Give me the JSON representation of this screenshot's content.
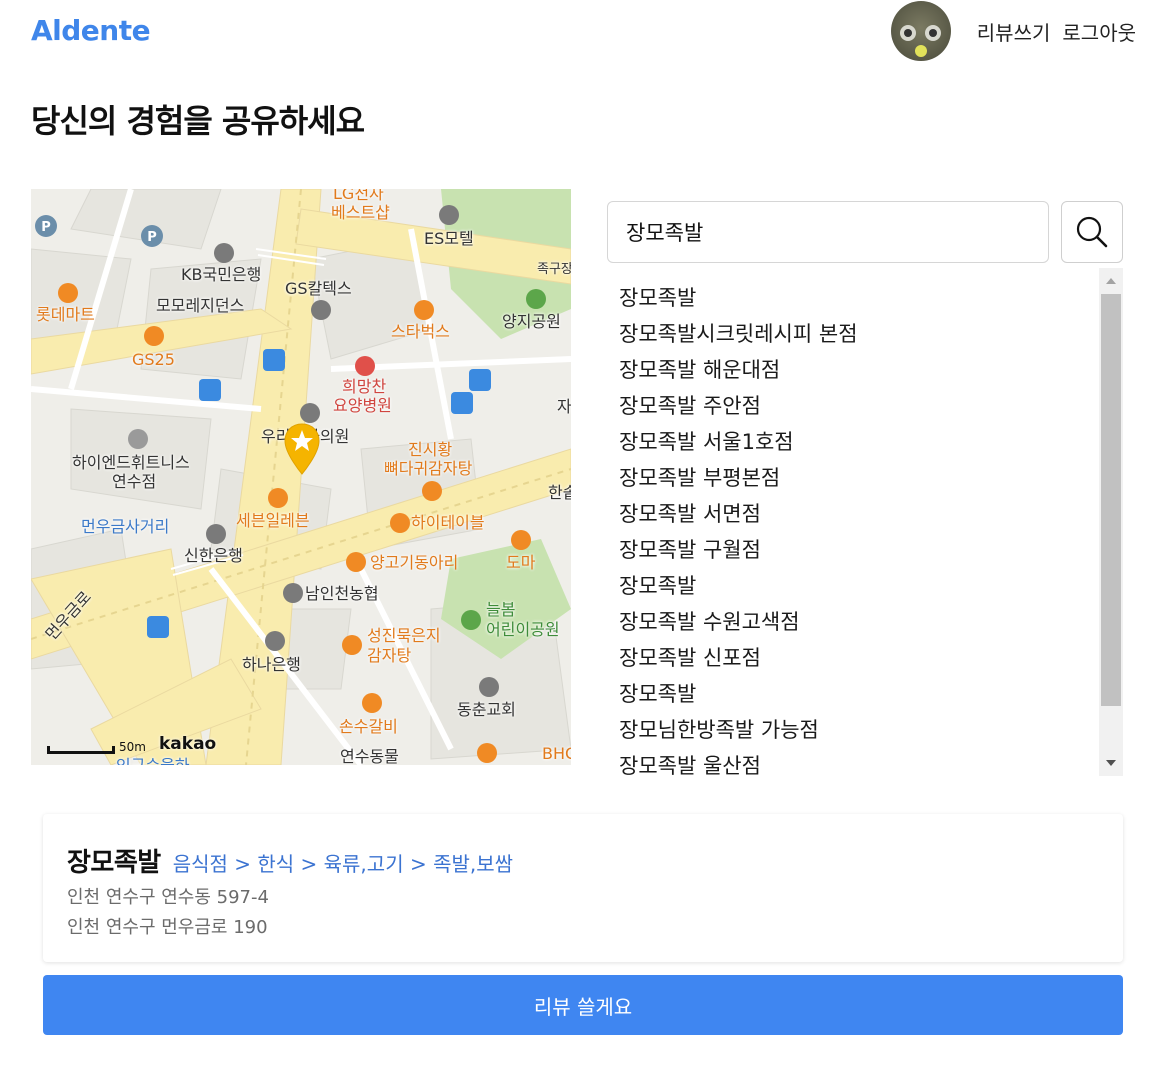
{
  "header": {
    "logo": "Aldente",
    "write_review_label": "리뷰쓰기",
    "logout_label": "로그아웃"
  },
  "page": {
    "title": "당신의 경험을 공유하세요"
  },
  "map": {
    "labels": {
      "lg": "LG전자",
      "best": "베스트샵",
      "es_motel": "ES모텔",
      "jokgu": "족구장",
      "kb": "KB국민은행",
      "momo": "모모레지던스",
      "gs_caltex": "GS칼텍스",
      "lotte_mart": "롯데마트",
      "yangji": "양지공원",
      "starbucks": "스타벅스",
      "gs25": "GS25",
      "hospital_1": "희망찬",
      "hospital_2": "요양병원",
      "clinic": "우리내과의원",
      "jin_1": "진시황",
      "jin_2": "뼈다귀감자탕",
      "hyend_1": "하이엔드휘트니스",
      "hyend_2": "연수점",
      "seven": "세븐일레븐",
      "hi_table": "하이테이블",
      "han": "한솥",
      "ja": "자",
      "meonu_st": "먼우금사거리",
      "shinhan": "신한은행",
      "yanggogi": "양고기동아리",
      "doma": "도마",
      "namin": "남인천농협",
      "meonu_ro": "먼우금로",
      "neulbom_1": "늘봄",
      "neulbom_2": "어린이공원",
      "sungjin_1": "성진묵은지",
      "sungjin_2": "감자탕",
      "hana": "하나은행",
      "dongchun": "동춘교회",
      "sonsu": "손수갈비",
      "yeonsu": "연수동물",
      "bhc": "BHC",
      "cut": "인구수을하"
    },
    "scale_label": "50m",
    "attribution": "kakao"
  },
  "search": {
    "value": "장모족발"
  },
  "results": [
    "장모족발",
    "장모족발시크릿레시피 본점",
    "장모족발 해운대점",
    "장모족발 주안점",
    "장모족발 서울1호점",
    "장모족발 부평본점",
    "장모족발 서면점",
    "장모족발 구월점",
    "장모족발",
    "장모족발 수원고색점",
    "장모족발 신포점",
    "장모족발",
    "장모님한방족발 가능점",
    "장모족발 울산점"
  ],
  "place": {
    "name": "장모족발",
    "category": "음식점 > 한식 > 육류,고기 > 족발,보쌈",
    "address_jibun": "인천 연수구 연수동 597-4",
    "address_road": "인천 연수구 먼우금로 190"
  },
  "submit": {
    "label": "리뷰 쓸게요"
  },
  "colors": {
    "brand": "#3f86ea",
    "button": "#3f86f1",
    "category_link": "#3b73d1",
    "road": "#f9ecae",
    "park": "#c8e2b0",
    "pin": "#f5b400"
  }
}
